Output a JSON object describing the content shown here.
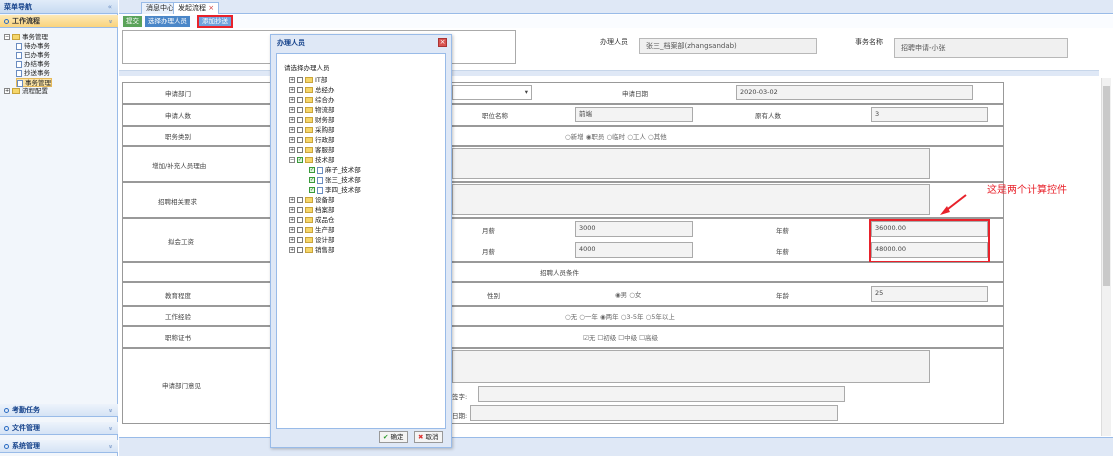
{
  "sidebar": {
    "title": "菜单导航",
    "collapse_glyph": "«",
    "sections": [
      {
        "label": "工作流程",
        "glyph": "»"
      },
      {
        "label": "考勤任务",
        "glyph": "»"
      },
      {
        "label": "文件管理",
        "glyph": "»"
      },
      {
        "label": "系统管理",
        "glyph": "»"
      }
    ],
    "tree": [
      {
        "label": "事务管理"
      },
      {
        "label": "待办事务"
      },
      {
        "label": "已办事务"
      },
      {
        "label": "办结事务"
      },
      {
        "label": "抄送事务"
      },
      {
        "label": "事务管理"
      },
      {
        "label": "流程配置"
      }
    ]
  },
  "tabs": [
    {
      "label": "消息中心"
    },
    {
      "label": "发起流程"
    }
  ],
  "toolbar": {
    "submit": "提交",
    "choose_handler": "选择办理人员",
    "add_cc": "添加抄送"
  },
  "header": {
    "handler_label": "办理人员",
    "handler_value": "张三_档案部(zhangsandab)",
    "task_label": "事务名称",
    "task_value": "招聘申请-小张"
  },
  "form": {
    "dept_label": "申请部门",
    "date_label": "申请日期",
    "date_value": "2020-03-02",
    "count_label": "申请人数",
    "position_label": "职位名称",
    "position_value": "前端",
    "orig_count_label": "原有人数",
    "orig_count_value": "3",
    "job_type_label": "职务类别",
    "job_type_options": "○新增 ◉职员 ○临时 ○工人 ○其他",
    "reason_label": "增加/补充人员理由",
    "requirement_label": "招聘相关要求",
    "salary_label": "拟会工资",
    "monthly_label": "月薪",
    "annual_label": "年薪",
    "monthly_1": "3000",
    "annual_1": "36000.00",
    "monthly_2": "4000",
    "annual_2": "48000.00",
    "conditions_label": "招聘人员条件",
    "edu_label": "教育程度",
    "gender_label": "性别",
    "gender_options": "◉男 ○女",
    "age_label": "年龄",
    "age_value": "25",
    "experience_label": "工作经验",
    "experience_options": "○无 ○一年 ◉两年 ○3-5年 ○5年以上",
    "cert_label": "职称证书",
    "cert_options": "☑无 ☐初级 ☐中级 ☐高级",
    "opinion_label": "申请部门意见",
    "sign_label": "签字:",
    "sign_date_label": "日期:"
  },
  "annotation": "这是两个计算控件",
  "dialog": {
    "title": "办理人员",
    "close_glyph": "×",
    "prompt": "请选择办理人员",
    "nodes": [
      {
        "label": "IT部"
      },
      {
        "label": "总经办"
      },
      {
        "label": "综合办"
      },
      {
        "label": "物流部"
      },
      {
        "label": "财务部"
      },
      {
        "label": "采购部"
      },
      {
        "label": "行政部"
      },
      {
        "label": "客服部"
      },
      {
        "label": "技术部"
      },
      {
        "label": "麻子_技术部"
      },
      {
        "label": "张三_技术部"
      },
      {
        "label": "李四_技术部"
      },
      {
        "label": "设备部"
      },
      {
        "label": "档案部"
      },
      {
        "label": "成品仓"
      },
      {
        "label": "生产部"
      },
      {
        "label": "设计部"
      },
      {
        "label": "销售部"
      }
    ],
    "confirm": "确定",
    "cancel": "取消"
  },
  "colors": {
    "accent": "#e8222b",
    "toolbar_green": "#5aa35a",
    "toolbar_blue": "#4a86c8"
  }
}
